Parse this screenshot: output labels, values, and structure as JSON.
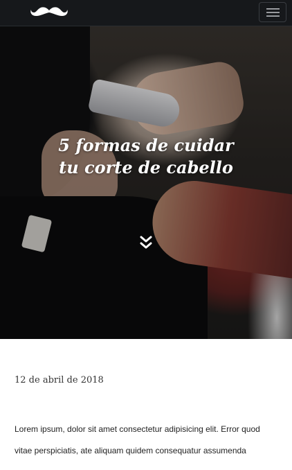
{
  "navbar": {
    "logo_icon": "mustache-icon",
    "menu_icon": "hamburger-menu-icon"
  },
  "hero": {
    "title_line1": "5 formas de cuidar",
    "title_line2": "tu corte de cabello",
    "scroll_icon": "double-chevron-down-icon"
  },
  "article": {
    "date": "12 de abril de 2018",
    "paragraph": "Lorem ipsum, dolor sit amet consectetur adipisicing elit. Error quod vitae perspiciatis, ate aliquam quidem consequatur assumenda"
  },
  "colors": {
    "navbar_bg": "#16181b",
    "hero_text": "#ffffff",
    "body_text": "#222222"
  }
}
